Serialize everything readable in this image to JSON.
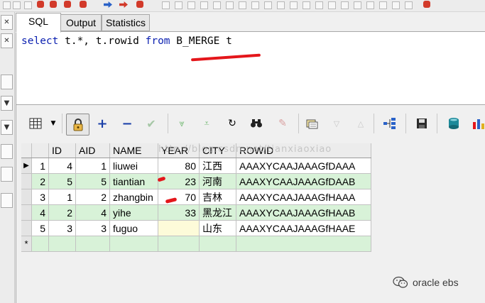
{
  "tabs": [
    {
      "label": "SQL",
      "active": true
    },
    {
      "label": "Output",
      "active": false
    },
    {
      "label": "Statistics",
      "active": false
    }
  ],
  "sql": {
    "kw_select": "select",
    "part1": " t.*, t.rowid ",
    "kw_from": "from",
    "part2": " B_MERGE t"
  },
  "grid": {
    "columns": [
      "ID",
      "AID",
      "NAME",
      "YEAR",
      "CITY",
      "ROWID"
    ],
    "rows": [
      {
        "num": "1",
        "ID": "4",
        "AID": "1",
        "NAME": "liuwei",
        "YEAR": "80",
        "CITY": "江西",
        "ROWID": "AAAXYCAAJAAAGfDAAA"
      },
      {
        "num": "2",
        "ID": "5",
        "AID": "5",
        "NAME": "tiantian",
        "YEAR": "23",
        "CITY": "河南",
        "ROWID": "AAAXYCAAJAAAGfDAAB"
      },
      {
        "num": "3",
        "ID": "1",
        "AID": "2",
        "NAME": "zhangbin",
        "YEAR": "70",
        "CITY": "吉林",
        "ROWID": "AAAXYCAAJAAAGfHAAA"
      },
      {
        "num": "4",
        "ID": "2",
        "AID": "4",
        "NAME": "yihe",
        "YEAR": "33",
        "CITY": "黑龙江",
        "ROWID": "AAAXYCAAJAAAGfHAAB"
      },
      {
        "num": "5",
        "ID": "3",
        "AID": "3",
        "NAME": "fuguo",
        "YEAR": "",
        "CITY": "山东",
        "ROWID": "AAAXYCAAJAAAGfHAAE"
      }
    ],
    "new_row_marker": "*",
    "current_row_marker": "▶"
  },
  "watermark": "http://blog.csdn.net/tianxiaoxiao",
  "brand": "oracle ebs",
  "colors": {
    "keyword": "#0a1fb0",
    "annotation": "#e4161b",
    "row_alt": "#d8f2d8"
  }
}
